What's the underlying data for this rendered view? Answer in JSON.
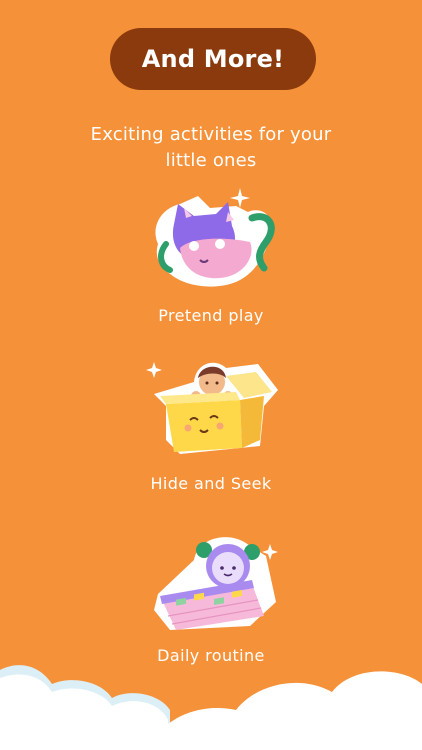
{
  "header": {
    "title": "And More!",
    "subtitle_line1": "Exciting activities for your",
    "subtitle_line2": "little ones"
  },
  "activities": [
    {
      "label": "Pretend play",
      "icon": "cat-teapot-icon"
    },
    {
      "label": "Hide and Seek",
      "icon": "box-hide-seek-icon"
    },
    {
      "label": "Daily routine",
      "icon": "calendar-clock-icon"
    }
  ],
  "colors": {
    "background": "#F59138",
    "title_pill": "#8A3A0C",
    "text": "#FFFFFF",
    "cloud": "#FFFFFF",
    "cloud_shade": "#DCEFF7"
  }
}
